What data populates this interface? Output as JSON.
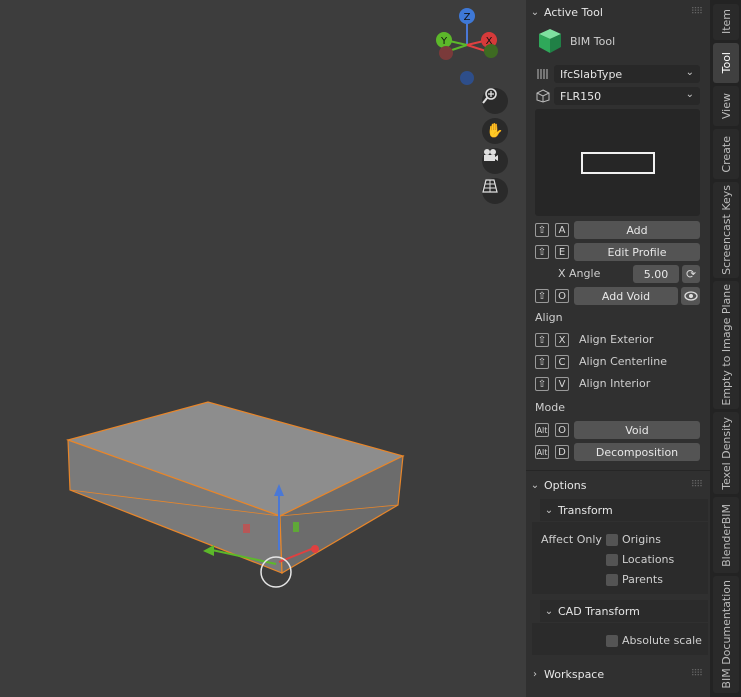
{
  "viewport": {
    "gizmo": {
      "z": "Z",
      "y": "Y",
      "x": "X"
    },
    "nav_icons": [
      "zoom-icon",
      "hand-pan-icon",
      "camera-icon",
      "grid-view-icon"
    ]
  },
  "panel": {
    "active_tool": {
      "header": "Active Tool",
      "tool_name": "BIM Tool",
      "type_select": "IfcSlabType",
      "profile_select": "FLR150",
      "add": {
        "key": "A",
        "label": "Add"
      },
      "edit_profile": {
        "key": "E",
        "label": "Edit Profile"
      },
      "x_angle": {
        "label": "X Angle",
        "value": "5.00"
      },
      "add_void": {
        "key": "O",
        "label": "Add Void"
      },
      "align_label": "Align",
      "align_exterior": {
        "key": "X",
        "label": "Align Exterior"
      },
      "align_centerline": {
        "key": "C",
        "label": "Align Centerline"
      },
      "align_interior": {
        "key": "V",
        "label": "Align Interior"
      },
      "mode_label": "Mode",
      "void": {
        "mod": "Alt",
        "key": "O",
        "label": "Void"
      },
      "decomposition": {
        "mod": "Alt",
        "key": "D",
        "label": "Decomposition"
      }
    },
    "options": {
      "header": "Options",
      "transform": {
        "header": "Transform",
        "affect_only": "Affect Only",
        "origins": "Origins",
        "locations": "Locations",
        "parents": "Parents"
      },
      "cad_transform": {
        "header": "CAD Transform",
        "absolute_scale": "Absolute scale"
      },
      "workspace": "Workspace"
    }
  },
  "tabs": [
    "Item",
    "Tool",
    "View",
    "Create",
    "Screencast Keys",
    "Empty to Image Plane",
    "Texel Density",
    "BlenderBIM",
    "BIM Documentation"
  ],
  "colors": {
    "accent": "#5680c2",
    "selection_outline": "#e8862a"
  }
}
